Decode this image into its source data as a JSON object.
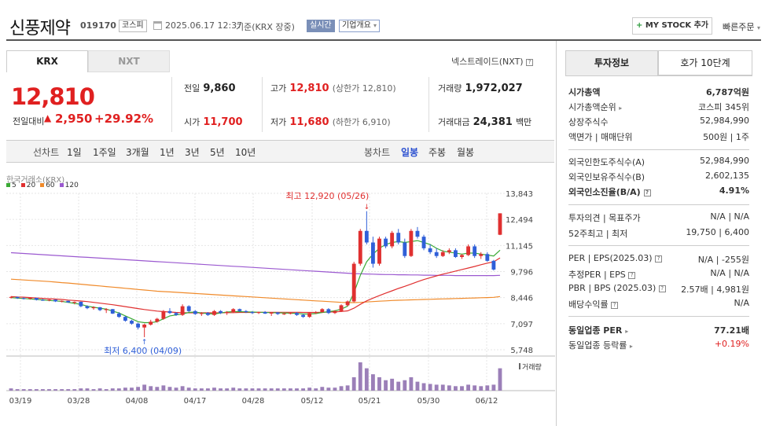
{
  "header": {
    "company_name": "신풍제약",
    "stock_code": "019170",
    "market_badge": "코스피",
    "datetime": "2025.06.17 12:37",
    "basis": "기준(KRX 장중)",
    "realtime_badge": "실시간",
    "company_overview": "기업개요",
    "my_stock_button": "MY STOCK 추가",
    "quick_order": "빠른주문"
  },
  "exchange_tabs": [
    "KRX",
    "NXT"
  ],
  "nextrade_link": "넥스트레이드(NXT)",
  "quote": {
    "current_price": "12,810",
    "change_label": "전일대비",
    "change_amount": "2,950",
    "change_rate": "+29.92%",
    "prev_close_label": "전일",
    "prev_close": "9,860",
    "open_label": "시가",
    "open": "11,700",
    "high_label": "고가",
    "high": "12,810",
    "high_limit_label": "(상한가 12,810)",
    "low_label": "저가",
    "low": "11,680",
    "low_limit_label": "(하한가 6,910)",
    "volume_label": "거래량",
    "volume": "1,972,027",
    "amount_label": "거래대금",
    "amount": "24,381",
    "amount_unit": "백만"
  },
  "period_tabs": {
    "left_label": "선차트",
    "left": [
      "1일",
      "1주일",
      "3개월",
      "1년",
      "3년",
      "5년",
      "10년"
    ],
    "right_label": "봉차트",
    "right": [
      "일봉",
      "주봉",
      "월봉"
    ],
    "active_right": "일봉"
  },
  "chart_data": {
    "type": "candlestick",
    "source_label": "한국거래소(KRX)",
    "legend": [
      {
        "name": "5",
        "color": "#3aaa35"
      },
      {
        "name": "20",
        "color": "#e03030"
      },
      {
        "name": "60",
        "color": "#f08a2a"
      },
      {
        "name": "120",
        "color": "#9b59d0"
      }
    ],
    "y_ticks": [
      "13,843",
      "12,494",
      "11,145",
      "9,796",
      "8,446",
      "7,097",
      "5,748"
    ],
    "ylim": [
      5748,
      13843
    ],
    "x_ticks": [
      "03/19",
      "03/28",
      "04/08",
      "04/17",
      "04/28",
      "05/12",
      "05/21",
      "05/30",
      "06/12"
    ],
    "annotation_high": "최고 12,920 (05/26)",
    "annotation_low": "최저 6,400 (04/09)",
    "volume_label": "거래량",
    "candles": [
      [
        8450,
        8520,
        8400,
        8480
      ],
      [
        8480,
        8500,
        8380,
        8420
      ],
      [
        8420,
        8460,
        8350,
        8400
      ],
      [
        8400,
        8450,
        8340,
        8430
      ],
      [
        8430,
        8440,
        8300,
        8330
      ],
      [
        8330,
        8380,
        8280,
        8300
      ],
      [
        8300,
        8360,
        8260,
        8340
      ],
      [
        8340,
        8350,
        8220,
        8250
      ],
      [
        8250,
        8300,
        8200,
        8280
      ],
      [
        8280,
        8290,
        8180,
        8200
      ],
      [
        8200,
        8250,
        8100,
        8230
      ],
      [
        8230,
        8240,
        7950,
        8000
      ],
      [
        8000,
        8050,
        7850,
        7900
      ],
      [
        7900,
        8000,
        7820,
        7950
      ],
      [
        7950,
        7960,
        7750,
        7800
      ],
      [
        7800,
        7900,
        7650,
        7850
      ],
      [
        7850,
        7860,
        7600,
        7620
      ],
      [
        7620,
        7700,
        7400,
        7450
      ],
      [
        7450,
        7500,
        7200,
        7250
      ],
      [
        7250,
        7300,
        7050,
        7100
      ],
      [
        7100,
        7150,
        6800,
        6900
      ],
      [
        6900,
        7100,
        6400,
        7050
      ],
      [
        7050,
        7300,
        7000,
        7200
      ],
      [
        7200,
        7400,
        7150,
        7350
      ],
      [
        7350,
        7800,
        7300,
        7750
      ],
      [
        7750,
        7900,
        7600,
        7650
      ],
      [
        7650,
        7700,
        7500,
        7550
      ],
      [
        7550,
        8100,
        7500,
        8000
      ],
      [
        8000,
        8050,
        7700,
        7750
      ],
      [
        7750,
        7800,
        7550,
        7600
      ],
      [
        7600,
        7700,
        7500,
        7650
      ],
      [
        7650,
        7700,
        7500,
        7550
      ],
      [
        7550,
        7800,
        7500,
        7750
      ],
      [
        7750,
        7800,
        7600,
        7650
      ],
      [
        7650,
        7750,
        7550,
        7700
      ],
      [
        7700,
        7900,
        7650,
        7850
      ],
      [
        7850,
        7880,
        7700,
        7750
      ],
      [
        7750,
        7800,
        7650,
        7700
      ],
      [
        7700,
        7750,
        7600,
        7650
      ],
      [
        7650,
        7720,
        7600,
        7700
      ],
      [
        7700,
        7750,
        7600,
        7620
      ],
      [
        7620,
        7700,
        7500,
        7680
      ],
      [
        7680,
        7700,
        7550,
        7600
      ],
      [
        7600,
        7650,
        7550,
        7620
      ],
      [
        7620,
        7700,
        7580,
        7650
      ],
      [
        7650,
        7700,
        7500,
        7550
      ],
      [
        7550,
        7600,
        7400,
        7450
      ],
      [
        7450,
        7700,
        7400,
        7650
      ],
      [
        7650,
        7750,
        7600,
        7700
      ],
      [
        7700,
        7900,
        7650,
        7850
      ],
      [
        7850,
        7900,
        7600,
        7650
      ],
      [
        7650,
        7800,
        7600,
        7750
      ],
      [
        7750,
        8100,
        7700,
        8050
      ],
      [
        8050,
        8300,
        8000,
        8250
      ],
      [
        8250,
        10300,
        8200,
        10200
      ],
      [
        10200,
        12000,
        10100,
        11900
      ],
      [
        11900,
        12920,
        11200,
        11300
      ],
      [
        11300,
        11600,
        10000,
        10200
      ],
      [
        10200,
        11600,
        10100,
        11500
      ],
      [
        11500,
        11600,
        11000,
        11100
      ],
      [
        11100,
        11900,
        11000,
        11800
      ],
      [
        11800,
        12000,
        11200,
        11300
      ],
      [
        11300,
        11500,
        10500,
        10600
      ],
      [
        10600,
        12000,
        10550,
        11900
      ],
      [
        11900,
        12100,
        11500,
        11600
      ],
      [
        11600,
        11700,
        10900,
        11000
      ],
      [
        11000,
        11200,
        10700,
        10800
      ],
      [
        10800,
        11000,
        10500,
        10600
      ],
      [
        10600,
        10900,
        10550,
        10800
      ],
      [
        10800,
        11000,
        10700,
        10900
      ],
      [
        10900,
        11000,
        10500,
        10550
      ],
      [
        10550,
        10700,
        10450,
        10650
      ],
      [
        10650,
        11200,
        10600,
        11100
      ],
      [
        11100,
        11200,
        10500,
        10600
      ],
      [
        10600,
        10800,
        10450,
        10700
      ],
      [
        10700,
        10800,
        10300,
        10350
      ],
      [
        10350,
        10400,
        9850,
        9900
      ],
      [
        11700,
        12810,
        11680,
        12810
      ]
    ],
    "volumes": [
      3,
      2,
      2,
      2,
      2,
      2,
      2,
      2,
      2,
      2,
      2,
      3,
      3,
      2,
      3,
      2,
      3,
      3,
      4,
      4,
      5,
      8,
      6,
      5,
      7,
      5,
      4,
      6,
      4,
      3,
      3,
      3,
      4,
      3,
      3,
      4,
      3,
      3,
      3,
      3,
      3,
      3,
      3,
      3,
      3,
      3,
      3,
      4,
      3,
      5,
      4,
      4,
      6,
      7,
      18,
      38,
      30,
      22,
      18,
      14,
      16,
      12,
      14,
      18,
      12,
      10,
      9,
      8,
      8,
      7,
      6,
      6,
      8,
      7,
      6,
      7,
      8,
      30
    ],
    "ma5": [
      8450,
      8420,
      8400,
      8380,
      8350,
      8330,
      8300,
      8280,
      8250,
      8200,
      8150,
      8100,
      8000,
      7950,
      7900,
      7850,
      7750,
      7650,
      7500,
      7350,
      7200,
      7150,
      7150,
      7200,
      7350,
      7500,
      7550,
      7600,
      7680,
      7700,
      7650,
      7620,
      7600,
      7650,
      7700,
      7720,
      7720,
      7710,
      7700,
      7690,
      7680,
      7670,
      7660,
      7650,
      7640,
      7630,
      7600,
      7600,
      7620,
      7680,
      7720,
      7760,
      7850,
      8000,
      8700,
      9600,
      10300,
      10700,
      11000,
      11200,
      11300,
      11350,
      11300,
      11350,
      11400,
      11300,
      11200,
      11000,
      10850,
      10800,
      10750,
      10700,
      10750,
      10750,
      10700,
      10650,
      10600,
      10900
    ],
    "ma20": [
      8500,
      8480,
      8470,
      8450,
      8430,
      8410,
      8390,
      8370,
      8350,
      8320,
      8300,
      8270,
      8240,
      8200,
      8160,
      8120,
      8080,
      8030,
      7980,
      7930,
      7880,
      7830,
      7790,
      7750,
      7720,
      7700,
      7680,
      7670,
      7660,
      7660,
      7660,
      7660,
      7660,
      7660,
      7670,
      7670,
      7680,
      7680,
      7680,
      7690,
      7690,
      7690,
      7690,
      7690,
      7690,
      7690,
      7680,
      7680,
      7680,
      7690,
      7700,
      7710,
      7730,
      7760,
      7900,
      8100,
      8280,
      8420,
      8550,
      8680,
      8800,
      8920,
      9030,
      9150,
      9270,
      9380,
      9480,
      9570,
      9660,
      9740,
      9820,
      9900,
      9980,
      10060,
      10150,
      10230,
      10300,
      10500
    ],
    "ma60": [
      9400,
      9380,
      9360,
      9340,
      9320,
      9300,
      9280,
      9250,
      9220,
      9200,
      9170,
      9140,
      9110,
      9080,
      9050,
      9020,
      8990,
      8960,
      8930,
      8900,
      8870,
      8840,
      8810,
      8780,
      8760,
      8740,
      8720,
      8700,
      8680,
      8660,
      8640,
      8620,
      8600,
      8580,
      8560,
      8540,
      8520,
      8500,
      8480,
      8460,
      8440,
      8420,
      8400,
      8380,
      8360,
      8340,
      8320,
      8300,
      8280,
      8260,
      8240,
      8220,
      8200,
      8190,
      8190,
      8200,
      8220,
      8240,
      8260,
      8280,
      8300,
      8310,
      8320,
      8330,
      8340,
      8350,
      8360,
      8370,
      8380,
      8390,
      8400,
      8410,
      8420,
      8430,
      8440,
      8450,
      8460,
      8500
    ],
    "ma120": [
      10770,
      10750,
      10730,
      10710,
      10690,
      10670,
      10650,
      10630,
      10610,
      10590,
      10570,
      10550,
      10530,
      10510,
      10490,
      10470,
      10450,
      10430,
      10410,
      10390,
      10370,
      10350,
      10330,
      10310,
      10290,
      10270,
      10250,
      10230,
      10210,
      10190,
      10170,
      10150,
      10130,
      10110,
      10090,
      10070,
      10050,
      10030,
      10010,
      9990,
      9970,
      9950,
      9930,
      9910,
      9890,
      9870,
      9850,
      9830,
      9810,
      9790,
      9770,
      9750,
      9730,
      9710,
      9690,
      9680,
      9670,
      9660,
      9650,
      9640,
      9640,
      9630,
      9630,
      9620,
      9620,
      9610,
      9610,
      9600,
      9600,
      9600,
      9590,
      9590,
      9590,
      9590,
      9590,
      9590,
      9590,
      9600
    ]
  },
  "right_panel": {
    "tabs": [
      "투자정보",
      "호가 10단계"
    ],
    "market_cap_label": "시가총액",
    "market_cap": "6,787억원",
    "market_cap_rank_label": "시가총액순위",
    "market_cap_rank": "코스피 345위",
    "shares_label": "상장주식수",
    "shares": "52,984,990",
    "par_label": "액면가 | 매매단위",
    "par": "500원 | 1주",
    "foreign_limit_label": "외국인한도주식수(A)",
    "foreign_limit": "52,984,990",
    "foreign_hold_label": "외국인보유주식수(B)",
    "foreign_hold": "2,602,135",
    "foreign_ratio_label": "외국인소진율(B/A)",
    "foreign_ratio": "4.91%",
    "opinion_label": "투자의견 | 목표주가",
    "opinion": "N/A | N/A",
    "week52_label": "52주최고 | 최저",
    "week52": "19,750 | 6,400",
    "per_label": "PER | EPS(2025.03)",
    "per": "N/A | -255원",
    "est_per_label": "추정PER | EPS",
    "est_per": "N/A | N/A",
    "pbr_label": "PBR | BPS (2025.03)",
    "pbr": "2.57배 | 4,981원",
    "div_label": "배당수익률",
    "div": "N/A",
    "sector_per_label": "동일업종 PER",
    "sector_per": "77.21배",
    "sector_rate_label": "동일업종 등락률",
    "sector_rate": "+0.19%"
  }
}
